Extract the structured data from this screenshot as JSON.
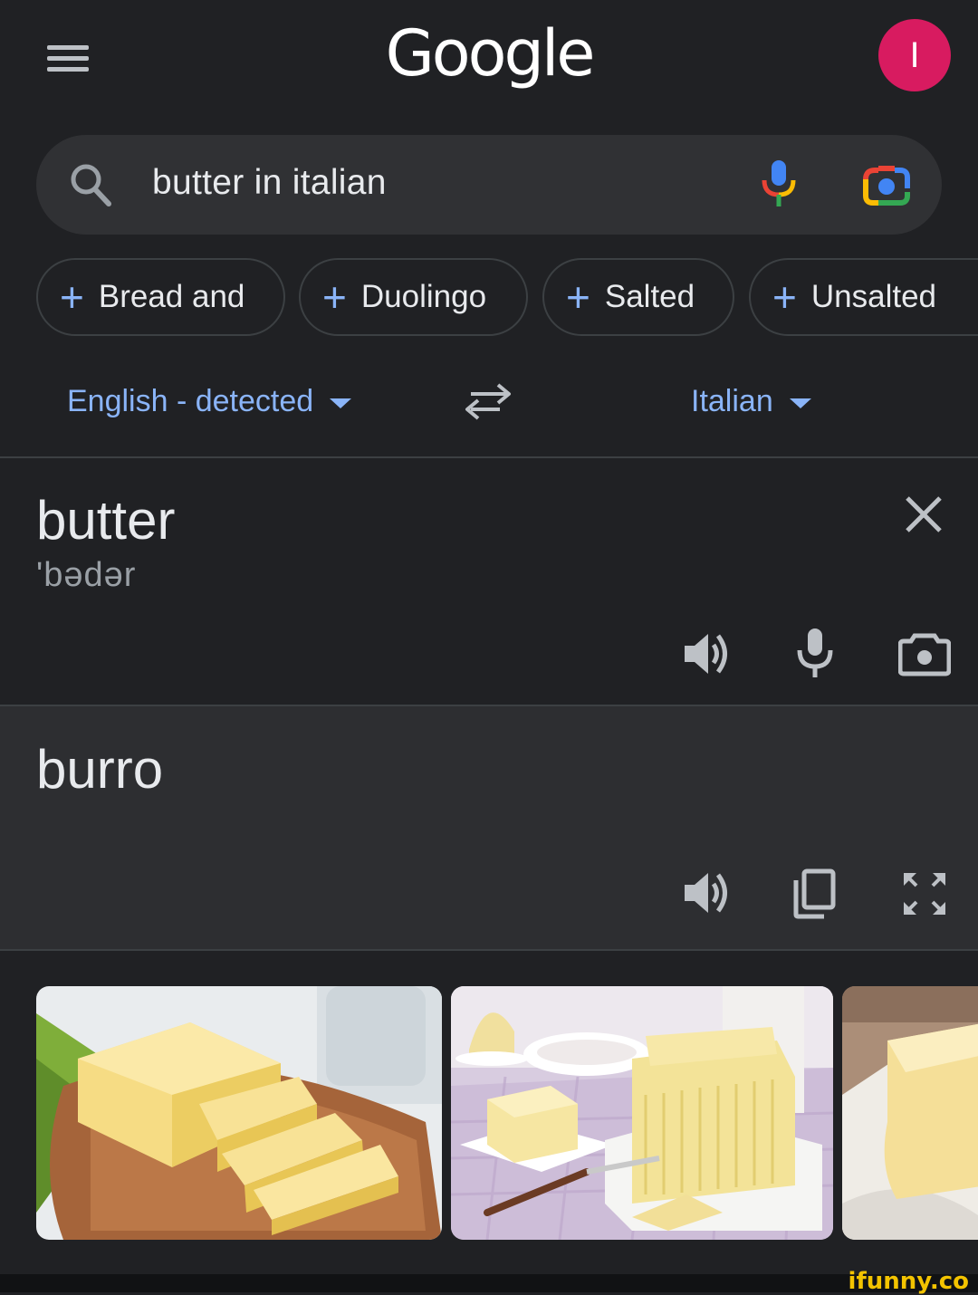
{
  "header": {
    "logo_text": "Google",
    "avatar_initial": "I"
  },
  "search": {
    "query": "butter in italian"
  },
  "chips": [
    {
      "label": "Bread and"
    },
    {
      "label": "Duolingo"
    },
    {
      "label": "Salted"
    },
    {
      "label": "Unsalted"
    }
  ],
  "translate": {
    "source_lang": "English - detected",
    "target_lang": "Italian",
    "source_text": "butter",
    "source_phonetic": "'bədər",
    "target_text": "burro"
  },
  "watermark": "ifunny.co",
  "colors": {
    "accent": "#8ab4f8",
    "avatar": "#d81b60",
    "background": "#202124",
    "panel": "#2d2e31"
  },
  "icons": [
    "menu-icon",
    "search-icon",
    "mic-icon",
    "lens-icon",
    "swap-icon",
    "close-icon",
    "speaker-icon",
    "camera-icon",
    "copy-icon",
    "fullscreen-icon"
  ]
}
